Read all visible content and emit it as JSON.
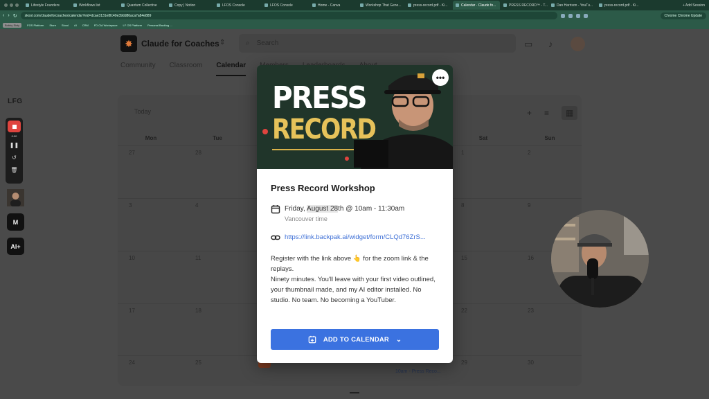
{
  "browser": {
    "tabs": [
      {
        "label": "Lifestyle Founders",
        "active": false
      },
      {
        "label": "Workflows list",
        "active": false
      },
      {
        "label": "Quantum Collective",
        "active": false
      },
      {
        "label": "Copy | Notion",
        "active": false
      },
      {
        "label": "LFOS Console",
        "active": false
      },
      {
        "label": "LFOS Console",
        "active": false
      },
      {
        "label": "Home - Canva",
        "active": false
      },
      {
        "label": "Workshop That Gene...",
        "active": false
      },
      {
        "label": "press-record.pdf - Ki...",
        "active": false
      },
      {
        "label": "Calendar · Claude fo...",
        "active": true
      },
      {
        "label": "PRESS RECORD™ - T...",
        "active": false
      },
      {
        "label": "Dan Harrison - YouTu...",
        "active": false
      },
      {
        "label": "press-record.pdf - Ki...",
        "active": false
      }
    ],
    "new_tab_label": "+ Add Session",
    "url": "skool.com/claudeforcoaches/calendar?eid=dcae3131e8fc40e39dd86aca7a84e889",
    "profile_pill": "Chrome Chrome Update",
    "bookmarks": [
      "Bobby Sixty",
      "FOS Platform",
      "Store",
      "Skool",
      "AI",
      "CRM",
      "FD ClA Workspace",
      "LF OS Platform",
      "Personal Backlog ..."
    ]
  },
  "header": {
    "brand_name": "Claude for Coaches",
    "search_placeholder": "Search",
    "nav_tabs": [
      "Community",
      "Classroom",
      "Calendar",
      "Members",
      "Leaderboards",
      "About"
    ],
    "active_tab": "Calendar"
  },
  "sidebar": {
    "lfg_label": "LFG",
    "recorder_time": "0:00",
    "tiles": [
      "",
      "M",
      "AI+"
    ]
  },
  "calendar": {
    "today_label": "Today",
    "weekdays": [
      "Mon",
      "Tue",
      "Wed",
      "Thu",
      "Fri",
      "Sat",
      "Sun"
    ],
    "rows": [
      [
        "27",
        "28",
        "",
        "",
        "",
        "1",
        "2"
      ],
      [
        "3",
        "4",
        "",
        "",
        "",
        "8",
        "9"
      ],
      [
        "10",
        "11",
        "",
        "",
        "",
        "15",
        "16"
      ],
      [
        "17",
        "18",
        "",
        "",
        "",
        "22",
        "23"
      ],
      [
        "24",
        "25",
        "",
        "",
        "",
        "29",
        "30"
      ]
    ],
    "event_label": "10am - Press Reco..."
  },
  "modal": {
    "cover_line1": "PRESS",
    "cover_line2": "RECORD",
    "title": "Press Record Workshop",
    "date_prefix": "Friday, ",
    "date_highlight": "August 28",
    "date_suffix": "th @ 10am - 11:30am",
    "timezone": "Vancouver time",
    "link": "https://link.backpak.ai/widget/form/CLQd76ZrS...",
    "description": [
      "Register with the link above 👆 for the zoom link & the replays.",
      "Ninety minutes. You'll leave with your first video outlined, your thumbnail made, and my AI editor installed. No studio. No team. No becoming a YouTuber."
    ],
    "add_button_label": "ADD TO CALENDAR"
  },
  "colors": {
    "accent_blue": "#3b72e0",
    "link_blue": "#3d6fd6",
    "recorder_red": "#e0443e",
    "title_gold": "#e6c25a",
    "browser_green": "#2c5a48"
  }
}
